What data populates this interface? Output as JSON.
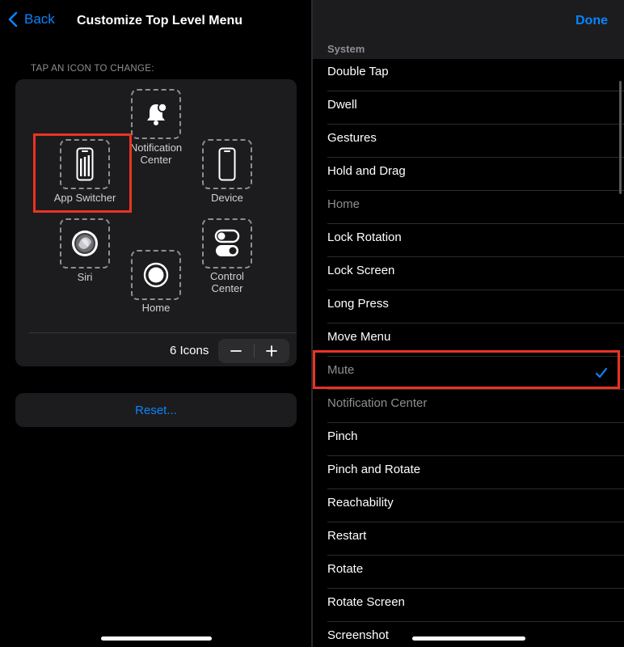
{
  "left": {
    "back_label": "Back",
    "title": "Customize Top Level Menu",
    "section_label": "TAP AN ICON TO CHANGE:",
    "slots": [
      {
        "label": "Notification\nCenter",
        "icon": "bell-icon"
      },
      {
        "label": "App Switcher",
        "icon": "app-switcher-icon"
      },
      {
        "label": "Device",
        "icon": "device-icon"
      },
      {
        "label": "Siri",
        "icon": "siri-icon"
      },
      {
        "label": "Control\nCenter",
        "icon": "control-center-icon"
      },
      {
        "label": "Home",
        "icon": "home-icon"
      }
    ],
    "icon_count_label": "6 Icons",
    "stepper": {
      "minus": "−",
      "plus": "+"
    },
    "reset_label": "Reset..."
  },
  "right": {
    "done_label": "Done",
    "group_header": "System",
    "items": [
      {
        "label": "Double Tap",
        "disabled": false,
        "checked": false
      },
      {
        "label": "Dwell",
        "disabled": false,
        "checked": false
      },
      {
        "label": "Gestures",
        "disabled": false,
        "checked": false
      },
      {
        "label": "Hold and Drag",
        "disabled": false,
        "checked": false
      },
      {
        "label": "Home",
        "disabled": true,
        "checked": false
      },
      {
        "label": "Lock Rotation",
        "disabled": false,
        "checked": false
      },
      {
        "label": "Lock Screen",
        "disabled": false,
        "checked": false
      },
      {
        "label": "Long Press",
        "disabled": false,
        "checked": false
      },
      {
        "label": "Move Menu",
        "disabled": false,
        "checked": false
      },
      {
        "label": "Mute",
        "disabled": true,
        "checked": true
      },
      {
        "label": "Notification Center",
        "disabled": true,
        "checked": false
      },
      {
        "label": "Pinch",
        "disabled": false,
        "checked": false
      },
      {
        "label": "Pinch and Rotate",
        "disabled": false,
        "checked": false
      },
      {
        "label": "Reachability",
        "disabled": false,
        "checked": false
      },
      {
        "label": "Restart",
        "disabled": false,
        "checked": false
      },
      {
        "label": "Rotate",
        "disabled": false,
        "checked": false
      },
      {
        "label": "Rotate Screen",
        "disabled": false,
        "checked": false
      },
      {
        "label": "Screenshot",
        "disabled": false,
        "checked": false
      }
    ]
  },
  "colors": {
    "accent": "#0a84ff",
    "highlight": "#ea3323",
    "panel": "#1c1c1e",
    "secondary_text": "#8e8e93"
  }
}
